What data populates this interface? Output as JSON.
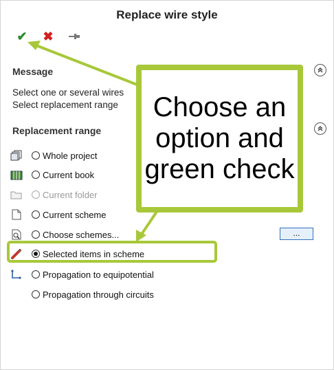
{
  "dialog": {
    "title": "Replace wire style"
  },
  "toolbar": {
    "ok_icon": "green-check-icon",
    "cancel_icon": "red-x-icon",
    "pin_icon": "pin-icon"
  },
  "message_section": {
    "title": "Message",
    "line1": "Select one or several wires",
    "line2": "Select replacement range"
  },
  "range_section": {
    "title": "Replacement range",
    "options": [
      {
        "label": "Whole project",
        "icon": "project-icon",
        "checked": false,
        "enabled": true
      },
      {
        "label": "Current book",
        "icon": "book-icon",
        "checked": false,
        "enabled": true
      },
      {
        "label": "Current folder",
        "icon": "folder-icon",
        "checked": false,
        "enabled": false
      },
      {
        "label": "Current scheme",
        "icon": "scheme-page-icon",
        "checked": false,
        "enabled": true
      },
      {
        "label": "Choose schemes...",
        "icon": "choose-schemes-icon",
        "checked": false,
        "enabled": true
      },
      {
        "label": "Selected items in scheme",
        "icon": "selected-items-icon",
        "checked": true,
        "enabled": true
      },
      {
        "label": "Propagation to equipotential",
        "icon": "equipotential-icon",
        "checked": false,
        "enabled": true
      },
      {
        "label": "Propagation through circuits",
        "icon": "",
        "checked": false,
        "enabled": true
      }
    ],
    "browse_label": "..."
  },
  "annotation": {
    "text": "Choose an option and green check"
  },
  "colors": {
    "annotation_green": "#a8c83a",
    "ok_green": "#2e8b2e",
    "cancel_red": "#d42020"
  }
}
